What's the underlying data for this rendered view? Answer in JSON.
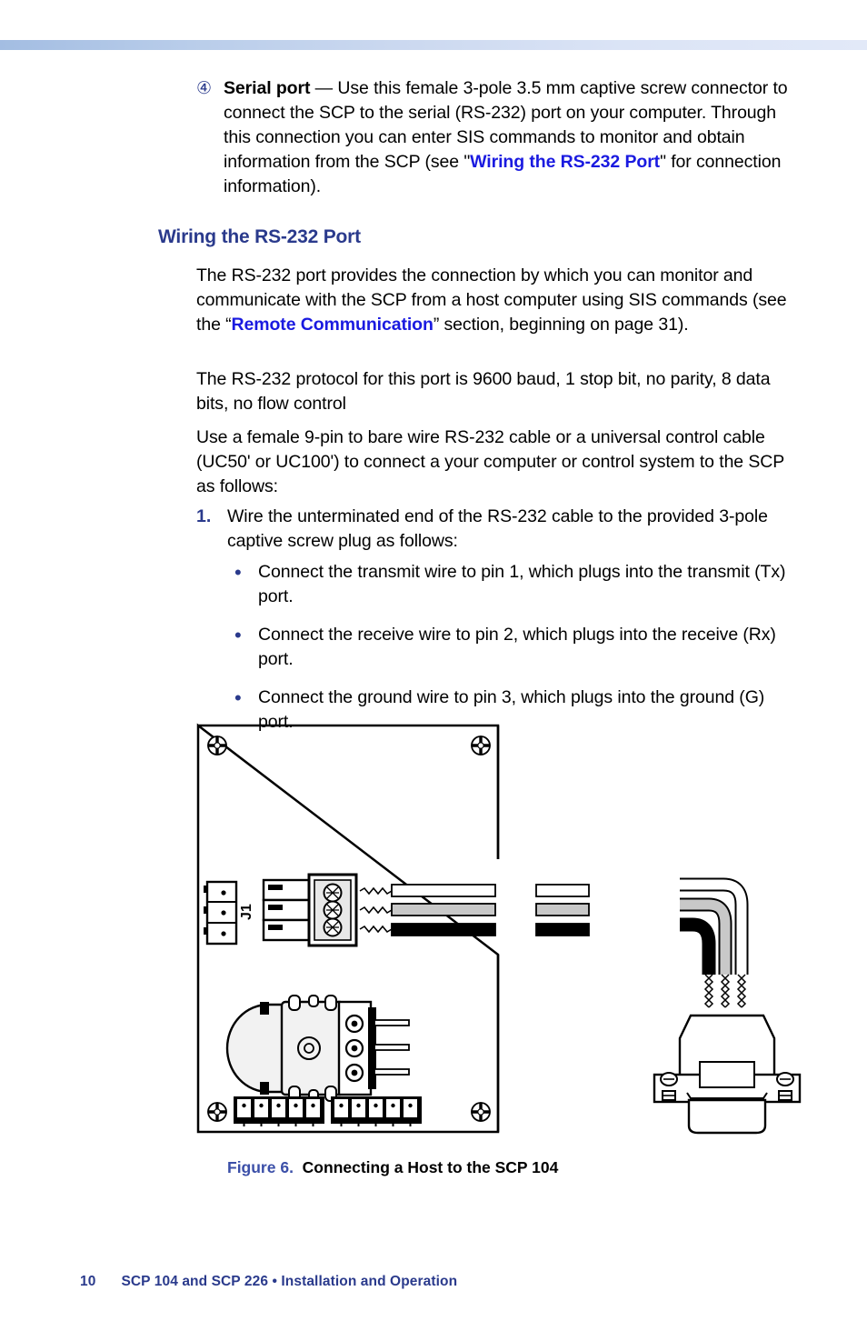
{
  "document": {
    "page_number": "10",
    "footer_title": "SCP 104 and SCP 226 • Installation and Operation"
  },
  "callout": {
    "marker": "④",
    "term": "Serial port",
    "dash": " — ",
    "text_before_link": "Use this female 3-pole 3.5 mm captive screw connector to connect the SCP to the serial (RS-232) port on your computer. Through this connection you can enter SIS commands to monitor and obtain information from the SCP (see \"",
    "link": "Wiring the RS-232 Port",
    "text_after_link": "\" for connection information)."
  },
  "section": {
    "heading": "Wiring the RS-232 Port",
    "paragraph_1_before": "The RS-232 port provides the connection by which you can monitor and communicate with the SCP from a host computer using SIS commands (see the “",
    "paragraph_1_link": "Remote Communication",
    "paragraph_1_after": "” section, beginning on page 31).",
    "paragraph_2": "The RS-232 protocol for this port is 9600 baud, 1 stop bit, no parity, 8 data bits, no flow control",
    "paragraph_3": "Use a female 9-pin to bare wire RS-232 cable or a universal control cable (UC50' or UC100') to connect a your computer or control system to the SCP as follows:"
  },
  "steps": [
    {
      "number": "1.",
      "text": "Wire the unterminated end of the RS-232 cable to the provided 3-pole captive screw plug as follows:"
    }
  ],
  "bullets": [
    {
      "marker": "•",
      "text": "Connect the transmit wire to pin 1, which plugs into the transmit (Tx) port."
    },
    {
      "marker": "•",
      "text": "Connect the receive wire to pin 2, which plugs into the receive (Rx) port."
    },
    {
      "marker": "•",
      "text": "Connect the ground wire to pin 3, which plugs into the ground (G) port."
    }
  ],
  "figure": {
    "label": "Figure 6.",
    "title": "Connecting a Host to the SCP 104",
    "pcb": {
      "connector_label": "J1",
      "wires": [
        {
          "name": "transmit-wire",
          "color": "#ffffff",
          "pin": "1"
        },
        {
          "name": "receive-wire",
          "color": "#c8c8c8",
          "pin": "2"
        },
        {
          "name": "ground-wire",
          "color": "#000000",
          "pin": "3"
        }
      ]
    }
  },
  "colors": {
    "heading_blue": "#2a3a8c",
    "link_blue": "#1a1ae0",
    "figure_num_blue": "#3b4fa8",
    "bar_left": "#a3bde2",
    "bar_right": "#e2e9f8"
  }
}
